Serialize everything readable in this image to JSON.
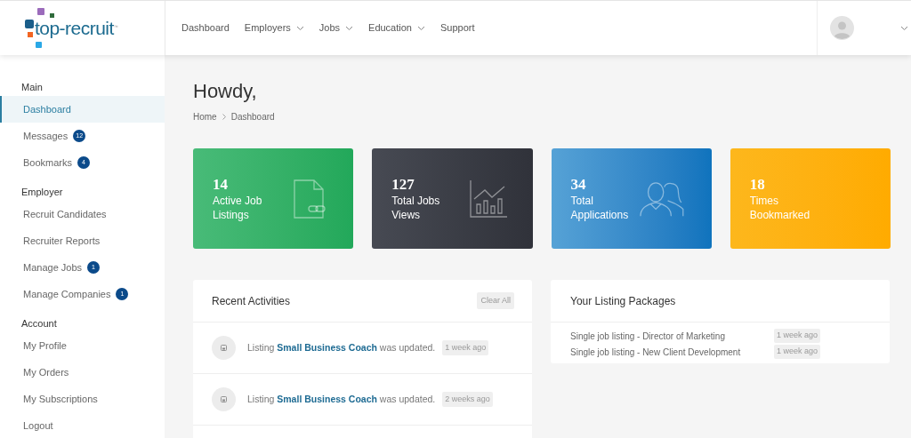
{
  "header": {
    "logo": "top-recruit",
    "logo_mark": "™",
    "nav": [
      {
        "label": "Dashboard",
        "dropdown": false
      },
      {
        "label": "Employers",
        "dropdown": true
      },
      {
        "label": "Jobs",
        "dropdown": true
      },
      {
        "label": "Education",
        "dropdown": true
      },
      {
        "label": "Support",
        "dropdown": false
      }
    ]
  },
  "sidebar": {
    "sections": [
      {
        "title": "Main",
        "items": [
          {
            "label": "Dashboard",
            "selected": true
          },
          {
            "label": "Messages",
            "selected": false,
            "badge": "12"
          },
          {
            "label": "Bookmarks",
            "selected": false,
            "badge": "4"
          }
        ]
      },
      {
        "title": "Employer",
        "items": [
          {
            "label": "Recruit Candidates",
            "selected": false
          },
          {
            "label": "Recruiter Reports",
            "selected": false
          },
          {
            "label": "Manage Jobs",
            "selected": false,
            "badge": "1"
          },
          {
            "label": "Manage Companies",
            "selected": false,
            "badge": "1"
          }
        ]
      },
      {
        "title": "Account",
        "items": [
          {
            "label": "My Profile",
            "selected": false
          },
          {
            "label": "My Orders",
            "selected": false
          },
          {
            "label": "My Subscriptions",
            "selected": false
          },
          {
            "label": "Logout",
            "selected": false
          }
        ]
      }
    ]
  },
  "page": {
    "title": "Howdy,",
    "breadcrumb": [
      "Home",
      "Dashboard"
    ]
  },
  "stats": [
    {
      "kind": "listings",
      "value": "14",
      "label": "Active Job Listings"
    },
    {
      "kind": "views",
      "value": "127",
      "label": "Total Jobs Views"
    },
    {
      "kind": "applications",
      "value": "34",
      "label": "Total Applications"
    },
    {
      "kind": "bookmarks",
      "value": "18",
      "label": "Times Bookmarked"
    }
  ],
  "activities": {
    "title": "Recent Activities",
    "clear_button": "Clear All",
    "items": [
      {
        "prefix": "Listing",
        "link": "Small Business Coach",
        "suffix": "was updated.",
        "time": "1 week ago"
      },
      {
        "prefix": "Listing",
        "link": "Small Business Coach",
        "suffix": "was updated.",
        "time": "2 weeks ago"
      }
    ]
  },
  "packages": {
    "title": "Your Listing Packages",
    "items": [
      {
        "name": "Single job listing - Director of Marketing",
        "time": "1 week ago"
      },
      {
        "name": "Single job listing - New Client Development",
        "time": "1 week ago"
      }
    ]
  }
}
